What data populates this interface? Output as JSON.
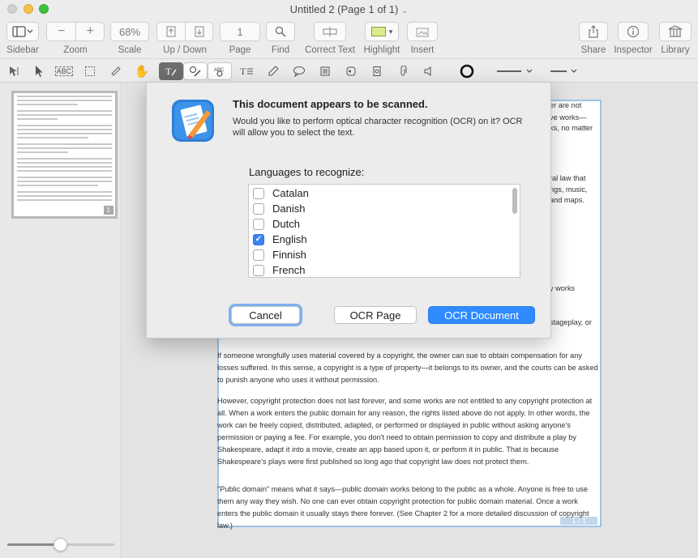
{
  "window": {
    "title": "Untitled 2 (Page 1 of 1)",
    "title_chevron": "⌄"
  },
  "toolbar": {
    "sidebar_label": "Sidebar",
    "zoom_label": "Zoom",
    "zoom_minus": "−",
    "zoom_plus": "+",
    "scale_label": "Scale",
    "scale_value": "68%",
    "updown_label": "Up / Down",
    "page_label": "Page",
    "page_value": "1",
    "find_label": "Find",
    "correct_text_label": "Correct Text",
    "highlight_label": "Highlight",
    "insert_label": "Insert",
    "share_label": "Share",
    "inspector_label": "Inspector",
    "library_label": "Library"
  },
  "dialog": {
    "title": "This document appears to be scanned.",
    "message": "Would you like to perform optical character recognition (OCR) on it? OCR will allow you to select the text.",
    "languages_label": "Languages to recognize:",
    "languages": [
      {
        "name": "Catalan",
        "checked": false
      },
      {
        "name": "Danish",
        "checked": false
      },
      {
        "name": "Dutch",
        "checked": false
      },
      {
        "name": "English",
        "checked": true
      },
      {
        "name": "Finnish",
        "checked": false
      },
      {
        "name": "French",
        "checked": false
      }
    ],
    "cancel": "Cancel",
    "ocr_page": "OCR Page",
    "ocr_document": "OCR Document"
  },
  "document": {
    "fragments": [
      "er are not",
      "ve works—",
      "ks, no matter",
      "ral law that",
      "ngs, music,",
      "and maps.",
      "y works",
      "stageplay, or"
    ],
    "para1": "If someone wrongfully uses material covered by a copyright, the owner can sue to obtain compensation for any losses suffered. In this sense, a copyright is a type of property—it belongs to its owner, and the courts can be asked to punish anyone who uses it without permission.",
    "para2": "However, copyright protection does not last forever, and some works are not entitled to any copyright protection at all. When a work enters the public domain for any reason, the rights listed above do not apply. In other words, the work can be freely copied, distributed, adapted, or performed or displayed in public without asking anyone's permission or paying a fee. For example, you don't need to obtain permission to copy and distribute a play by Shakespeare, adapt it into a movie, create an app based upon it, or perform it in public. That is because Shakespeare's plays were first published so long ago that copyright law does not protect them.",
    "para3": "\"Public domain\" means what it says—public domain works belong to the public as a whole. Anyone is free to use them any way they wish. No one can ever obtain copyright protection for public domain material. Once a work enters the public domain it usually stays there forever. (See Chapter 2 for a more detailed discussion of copyright law.)",
    "page_indicator": "1 / 1",
    "thumb_indicator": "1"
  },
  "sidebar": {
    "thumbnail_zoom": 0.5
  }
}
